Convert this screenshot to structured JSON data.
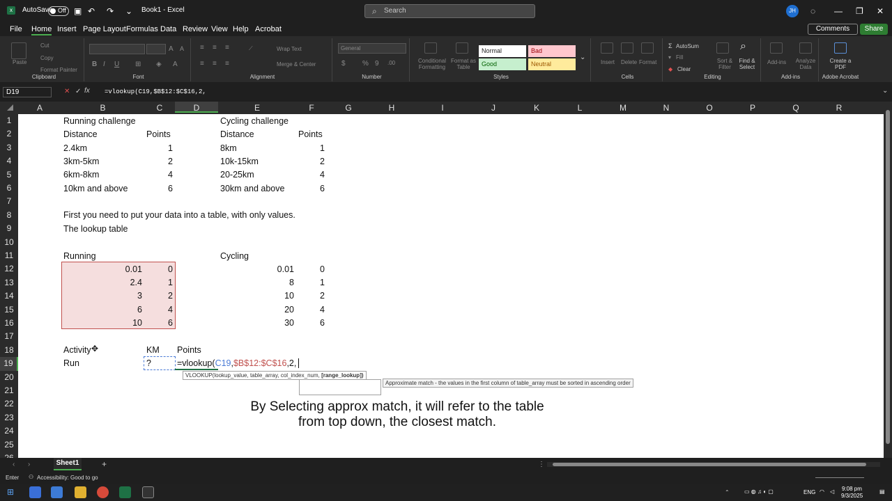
{
  "titlebar": {
    "autosave": "AutoSave",
    "toggle": "Off",
    "title": "Book1 - Excel",
    "search_placeholder": "Search",
    "user_initials": "JH"
  },
  "menu": [
    "File",
    "Home",
    "Insert",
    "Page Layout",
    "Formulas",
    "Data",
    "Review",
    "View",
    "Help",
    "Acrobat"
  ],
  "menu_buttons": {
    "comments": "Comments",
    "share": "Share"
  },
  "ribbon": {
    "groups": [
      "Clipboard",
      "Font",
      "Alignment",
      "Number",
      "Styles",
      "Cells",
      "Editing",
      "Add-ins",
      "Adobe Acrobat"
    ],
    "clipboard": {
      "paste": "Paste",
      "cut": "Cut",
      "copy": "Copy",
      "format_painter": "Format Painter"
    },
    "alignment": {
      "wrap": "Wrap Text",
      "merge": "Merge & Center"
    },
    "number": {
      "format": "General"
    },
    "styles": {
      "cond": "Conditional Formatting",
      "table": "Format as Table",
      "normal": "Normal",
      "bad": "Bad",
      "good": "Good",
      "neutral": "Neutral"
    },
    "cells": {
      "insert": "Insert",
      "delete": "Delete",
      "format": "Format"
    },
    "editing": {
      "autosum": "AutoSum",
      "fill": "Fill",
      "clear": "Clear",
      "sort": "Sort & Filter",
      "find": "Find & Select"
    },
    "addins": {
      "addins": "Add-ins",
      "analyze": "Analyze Data"
    },
    "acrobat": {
      "create": "Create a PDF"
    },
    "colors": {
      "normal_bg": "#ffffff",
      "bad_bg": "#ffc7ce",
      "good_bg": "#c6efce",
      "neutral_bg": "#ffeb9c"
    }
  },
  "formula_bar": {
    "name_box": "D19",
    "formula": "=vlookup(C19,$B$12:$C$16,2,"
  },
  "columns": [
    "A",
    "B",
    "C",
    "D",
    "E",
    "F",
    "G",
    "H",
    "I",
    "J",
    "K",
    "L",
    "M",
    "N",
    "O",
    "P",
    "Q",
    "R"
  ],
  "rows": [
    "1",
    "2",
    "3",
    "4",
    "5",
    "6",
    "7",
    "8",
    "9",
    "10",
    "11",
    "12",
    "13",
    "14",
    "15",
    "16",
    "17",
    "18",
    "19",
    "20",
    "21",
    "22",
    "23",
    "24",
    "25",
    "26"
  ],
  "cells": {
    "b1": "Running challenge",
    "e1": "Cycling challenge",
    "b2": "Distance",
    "c2": "Points",
    "e2": "Distance",
    "f2": "Points",
    "b3": "2.4km",
    "c3": "1",
    "e3": "8km",
    "f3": "1",
    "b4": "3km-5km",
    "c4": "2",
    "e4": "10k-15km",
    "f4": "2",
    "b5": "6km-8km",
    "c5": "4",
    "e5": "20-25km",
    "f5": "4",
    "b6": "10km and above",
    "c6": "6",
    "e6": "30km and above",
    "f6": "6",
    "b8": "First you need to put your data into a table, with only values.",
    "b9": "The lookup table",
    "b11": "Running",
    "e11": "Cycling",
    "b12": "0.01",
    "c12": "0",
    "e12": "0.01",
    "f12": "0",
    "b13": "2.4",
    "c13": "1",
    "e13": "8",
    "f13": "1",
    "b14": "3",
    "c14": "2",
    "e14": "10",
    "f14": "2",
    "b15": "6",
    "c15": "4",
    "e15": "20",
    "f15": "4",
    "b16": "10",
    "c16": "6",
    "e16": "30",
    "f16": "6",
    "b18": "Activity",
    "c18": "KM",
    "d18": "Points",
    "b19": "Run",
    "c19": "?",
    "d19_prefix": "=vlookup(",
    "d19_ref1": "C19",
    "d19_comma1": ",",
    "d19_ref2": "$B$12:$C$16",
    "d19_rest": ",2,"
  },
  "tooltip_syntax": {
    "text": "VLOOKUP(lookup_value, table_array, col_index_num, ",
    "bold": "[range_lookup])"
  },
  "tooltip_approx": "Approximate match - the values in the first column of table_array must be sorted in ascending order",
  "caption": {
    "line1": "By Selecting approx match, it will refer to the table",
    "line2": "from top down, the closest match."
  },
  "sheet": {
    "tab": "Sheet1"
  },
  "status": {
    "mode": "Enter",
    "accessibility": "Accessibility: Good to go"
  },
  "taskbar": {
    "lang": "ENG",
    "time": "9:08 pm",
    "date": "9/3/2025"
  }
}
